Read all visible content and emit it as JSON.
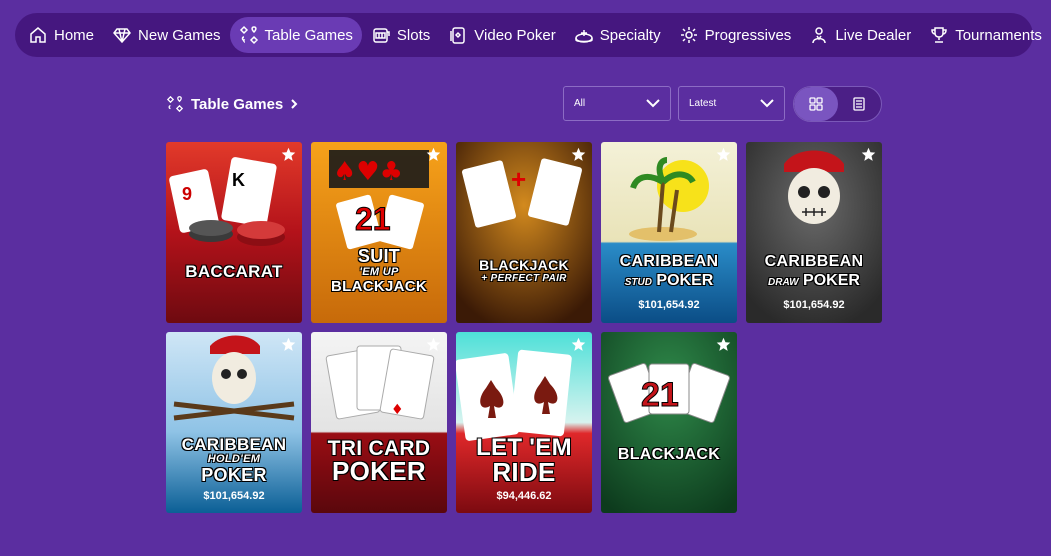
{
  "nav": {
    "items": [
      {
        "label": "Home",
        "icon": "home-icon"
      },
      {
        "label": "New Games",
        "icon": "diamond-icon"
      },
      {
        "label": "Table Games",
        "icon": "card-suits-icon"
      },
      {
        "label": "Slots",
        "icon": "slot-machine-icon"
      },
      {
        "label": "Video Poker",
        "icon": "video-poker-icon"
      },
      {
        "label": "Specialty",
        "icon": "specialty-icon"
      },
      {
        "label": "Progressives",
        "icon": "progressives-icon"
      },
      {
        "label": "Live Dealer",
        "icon": "live-dealer-icon"
      },
      {
        "label": "Tournaments",
        "icon": "trophy-icon"
      }
    ],
    "active": "Table Games"
  },
  "section": {
    "title": "Table Games",
    "filter_value": "All",
    "sort_value": "Latest",
    "view_mode": "grid"
  },
  "games": [
    {
      "title1": "BACCARAT",
      "title2": "",
      "title3": "",
      "jackpot": "",
      "theme": "red"
    },
    {
      "title1": "SUIT",
      "title2": "'EM UP",
      "title3": "BLACKJACK",
      "jackpot": "",
      "theme": "orange"
    },
    {
      "title1": "BLACKJACK",
      "title2": "+ PERFECT PAIR",
      "title3": "",
      "jackpot": "",
      "theme": "brown"
    },
    {
      "title1": "CARIBBEAN",
      "title2": "STUD",
      "title3": "POKER",
      "jackpot": "$101,654.92",
      "theme": "beach"
    },
    {
      "title1": "CARIBBEAN",
      "title2": "DRAW",
      "title3": "POKER",
      "jackpot": "$101,654.92",
      "theme": "gray"
    },
    {
      "title1": "CARIBBEAN",
      "title2": "HOLD'EM",
      "title3": "POKER",
      "jackpot": "$101,654.92",
      "theme": "sky"
    },
    {
      "title1": "TRI CARD",
      "title2": "POKER",
      "title3": "",
      "jackpot": "",
      "theme": "maroon"
    },
    {
      "title1": "LET 'EM",
      "title2": "RIDE",
      "title3": "",
      "jackpot": "$94,446.62",
      "theme": "teal-red"
    },
    {
      "title1": "BLACKJACK",
      "title2": "",
      "title3": "",
      "jackpot": "",
      "theme": "green"
    }
  ],
  "colors": {
    "background": "#5b2ea0",
    "nav_background": "#45177f",
    "nav_active": "#6a3bb4"
  }
}
